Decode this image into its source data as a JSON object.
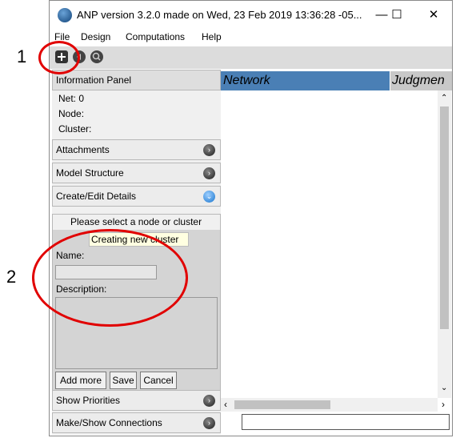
{
  "annotations": {
    "marker1": "1",
    "marker2": "2"
  },
  "window": {
    "title": "ANP version 3.2.0 made on Wed, 23 Feb 2019 13:36:28 -05...",
    "minimize": "—",
    "maximize": "☐",
    "close": "✕"
  },
  "menu": {
    "file": "File",
    "design": "Design",
    "computations": "Computations",
    "help": "Help"
  },
  "toolbar": {
    "icons": [
      "add-icon",
      "back-icon",
      "search-icon"
    ]
  },
  "left_panel": {
    "information_panel": "Information Panel",
    "net": "Net: 0",
    "node": "Node:",
    "cluster": "Cluster:",
    "attachments": "Attachments",
    "model_structure": "Model Structure",
    "create_edit_details": "Create/Edit Details",
    "select_prompt": "Please select a node or cluster",
    "tooltip": "Creating new cluster",
    "name_label": "Name:",
    "name_value": "",
    "description_label": "Description:",
    "description_value": "",
    "add_more": "Add more",
    "save": "Save",
    "cancel": "Cancel",
    "show_priorities": "Show Priorities",
    "make_show_connections": "Make/Show Connections"
  },
  "right_panel": {
    "network_tab": "Network",
    "judgments_tab": "Judgmen"
  },
  "colors": {
    "network_tab": "#4a7fb5",
    "annotation_red": "#e10000"
  }
}
